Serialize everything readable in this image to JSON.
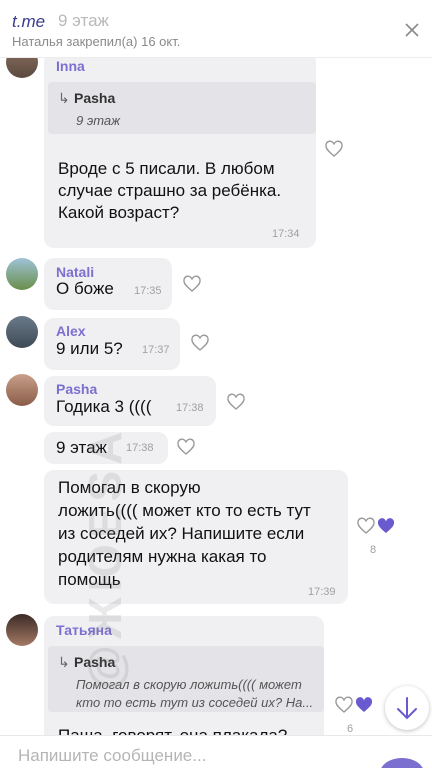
{
  "pinned": {
    "brand": "t.me",
    "floor_text": "9 этаж",
    "subtitle": "Наталья закрепил(а) 16 окт."
  },
  "watermark": "@ЖЮЕSA",
  "messages": [
    {
      "name": "Inna",
      "reply": {
        "name": "Pasha",
        "text": "9 этаж"
      },
      "lines": [
        "Вроде с 5 писали. В любом",
        "случае страшно за ребёнка.",
        "Какой возраст?"
      ],
      "time": "17:34"
    },
    {
      "name": "Natali",
      "text": "О боже",
      "time": "17:35"
    },
    {
      "name": "Alex",
      "text": "9 или 5?",
      "time": "17:37"
    },
    {
      "name": "Pasha",
      "text": "Годика 3 ((((",
      "time": "17:38"
    },
    {
      "text": "9 этаж",
      "time": "17:38"
    },
    {
      "lines": [
        "Помогал в скорую",
        "ложить(((( может кто то есть тут",
        "из соседей их? Напишите если",
        "родителям нужна какая то",
        "помощь"
      ],
      "time": "17:39",
      "reactions_count": "8"
    },
    {
      "name": "Татьяна",
      "reply": {
        "name": "Pasha",
        "lines": [
          "Помогал в скорую ложить(((( может",
          "кто то есть тут из соседей их? На..."
        ]
      },
      "text": "Паша, говорят, она плакала?",
      "reactions_count": "6"
    }
  ],
  "input": {
    "placeholder": "Напишите сообщение..."
  },
  "colors": {
    "accent": "#7b6fd0",
    "bubble": "#f0f0f2"
  }
}
